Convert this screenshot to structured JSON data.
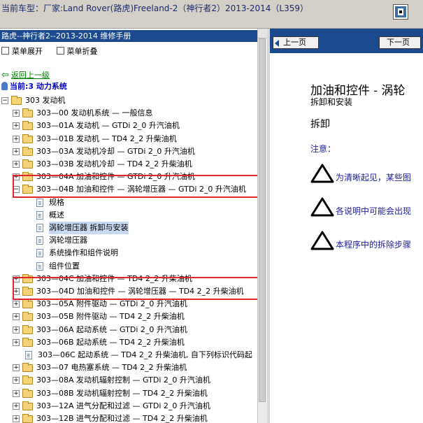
{
  "topbar": {
    "car_label": "当前车型：厂家:Land Rover(路虎)Freeland-2（神行者2）2013-2014（L359）",
    "exit_icon": "exit-door-icon"
  },
  "left": {
    "title": "路虎--神行者2--2013-2014 维修手册",
    "menu_expand": "菜单展开",
    "menu_collapse": "菜单折叠",
    "back_link": "返回上一级",
    "current": "当前:3 动力系统",
    "tree": [
      {
        "label": "303 发动机",
        "type": "folder",
        "exp": "−",
        "indent": 1
      },
      {
        "label": "303—00 发动机系统 — 一般信息",
        "type": "folder",
        "exp": "+",
        "indent": 2
      },
      {
        "label": "303—01A 发动机 — GTDi 2_0 升汽油机",
        "type": "folder",
        "exp": "+",
        "indent": 2
      },
      {
        "label": "303—01B 发动机 — TD4 2_2 升柴油机",
        "type": "folder",
        "exp": "+",
        "indent": 2
      },
      {
        "label": "303—03A 发动机冷却 — GTDi 2_0 升汽油机",
        "type": "folder",
        "exp": "+",
        "indent": 2
      },
      {
        "label": "303—03B 发动机冷却 — TD4 2_2 升柴油机",
        "type": "folder",
        "exp": "+",
        "indent": 2
      },
      {
        "label": "303—04A 加油和控件 — GTDi 2_0 升汽油机",
        "type": "folder",
        "exp": "+",
        "indent": 2
      },
      {
        "label": "303—04B 加油和控件 — 涡轮增压器 — GTDi 2_0 升汽油机",
        "type": "folder",
        "exp": "−",
        "indent": 2
      },
      {
        "label": "规格",
        "type": "doc",
        "indent": 3
      },
      {
        "label": "概述",
        "type": "doc",
        "indent": 3
      },
      {
        "label": "涡轮增压器 拆卸与安装",
        "type": "doc",
        "indent": 3,
        "selected": true
      },
      {
        "label": "涡轮增压器",
        "type": "doc",
        "indent": 3
      },
      {
        "label": "系统操作和组件说明",
        "type": "doc",
        "indent": 3
      },
      {
        "label": "组件位置",
        "type": "doc",
        "indent": 3
      },
      {
        "label": "303—04C 加油和控件 — TD4 2_2 升柴油机",
        "type": "folder",
        "exp": "+",
        "indent": 2
      },
      {
        "label": "303—04D 加油和控件 — 涡轮增压器 — TD4 2_2 升柴油机",
        "type": "folder",
        "exp": "+",
        "indent": 2
      },
      {
        "label": "303—05A 附件驱动 — GTDi 2_0 升汽油机",
        "type": "folder",
        "exp": "+",
        "indent": 2
      },
      {
        "label": "303—05B 附件驱动 — TD4 2_2 升柴油机",
        "type": "folder",
        "exp": "+",
        "indent": 2
      },
      {
        "label": "303—06A 起动系统 — GTDi 2_0 升汽油机",
        "type": "folder",
        "exp": "+",
        "indent": 2
      },
      {
        "label": "303—06B 起动系统 — TD4 2_2 升柴油机",
        "type": "folder",
        "exp": "+",
        "indent": 2
      },
      {
        "label": "303—06C 起动系统 — TD4 2_2 升柴油机, 自下列标识代码起",
        "type": "doc",
        "indent": 2
      },
      {
        "label": "303—07 电热塞系统 — TD4 2_2 升柴油机",
        "type": "folder",
        "exp": "+",
        "indent": 2
      },
      {
        "label": "303—08A 发动机辐射控制 — GTDi 2_0 升汽油机",
        "type": "folder",
        "exp": "+",
        "indent": 2
      },
      {
        "label": "303—08B 发动机辐射控制 — TD4 2_2 升柴油机",
        "type": "folder",
        "exp": "+",
        "indent": 2
      },
      {
        "label": "303—12A 进气分配和过滤 — GTDi 2_0 升汽油机",
        "type": "folder",
        "exp": "+",
        "indent": 2
      },
      {
        "label": "303—12B 进气分配和过滤 — TD4 2_2 升柴油机",
        "type": "folder",
        "exp": "+",
        "indent": 2
      }
    ]
  },
  "right": {
    "prev": "上一页",
    "next": "下一页",
    "title": "加油和控件 - 涡轮",
    "subtitle": "拆卸和安装",
    "heading": "拆卸",
    "note_label": "注意：",
    "warnings": [
      "为清晰起见，某些图",
      "各说明中可能会出现",
      "本程序中的拆除步骤"
    ]
  },
  "colors": {
    "nav_blue": "#1b4a8f",
    "highlight_red": "#e0262b",
    "link_green": "#008000"
  }
}
